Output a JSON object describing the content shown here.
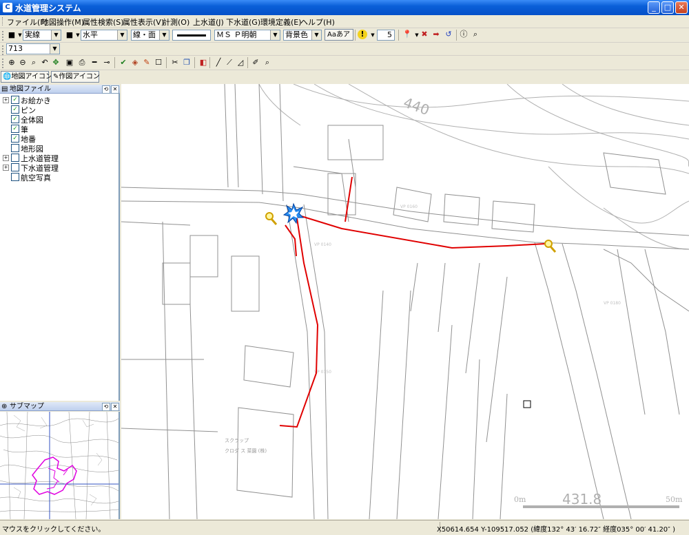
{
  "window": {
    "title": "水道管理システム",
    "icon": "app-icon",
    "min_label": "_",
    "max_label": "□",
    "close_label": "✕"
  },
  "menu": [
    "ファイル(F)",
    "地図操作(M)",
    "属性検索(S)",
    "属性表示(V)",
    "計測(O)",
    "上水道(J)",
    "下水道(G)",
    "環境定義(E)",
    "ヘルプ(H)"
  ],
  "toolbar1": {
    "line_type": "実線",
    "line_type2": "水平",
    "shape": "線・面",
    "font": "ＭＳ Ｐ明朝",
    "background": "背景色",
    "font_sample": "Aaあア",
    "number": "5"
  },
  "toolbar2": {
    "scale": "713"
  },
  "tabs": {
    "map_icon": "地図アイコン",
    "draw_icon": "作図アイコン"
  },
  "layer_panel": {
    "title": "地図ファイル",
    "items": [
      {
        "label": "お絵かき",
        "checked": true,
        "expandable": true
      },
      {
        "label": "ピン",
        "checked": true,
        "expandable": false
      },
      {
        "label": "全体図",
        "checked": true,
        "expandable": false
      },
      {
        "label": "筆",
        "checked": true,
        "expandable": false
      },
      {
        "label": "地番",
        "checked": true,
        "expandable": false
      },
      {
        "label": "地形図",
        "checked": false,
        "expandable": false
      },
      {
        "label": "上水道管理",
        "checked": false,
        "expandable": true
      },
      {
        "label": "下水道管理",
        "checked": false,
        "expandable": true
      },
      {
        "label": "航空写真",
        "checked": false,
        "expandable": false
      }
    ]
  },
  "submap": {
    "title": "サブマップ"
  },
  "map": {
    "contour_label": "440",
    "scale_label": "431.8",
    "scale_start": "0m",
    "scale_end": "50m",
    "building_text1": "スクラップ",
    "building_text2": "クロダ ス 菜園 (株)",
    "pipe_color": "#e00000"
  },
  "status": {
    "message": "マウスをクリックしてください。",
    "coords": "X50614.654 Y-109517.052 (緯度132° 43′ 16.72″ 経度035° 00′ 41.20″ )"
  }
}
